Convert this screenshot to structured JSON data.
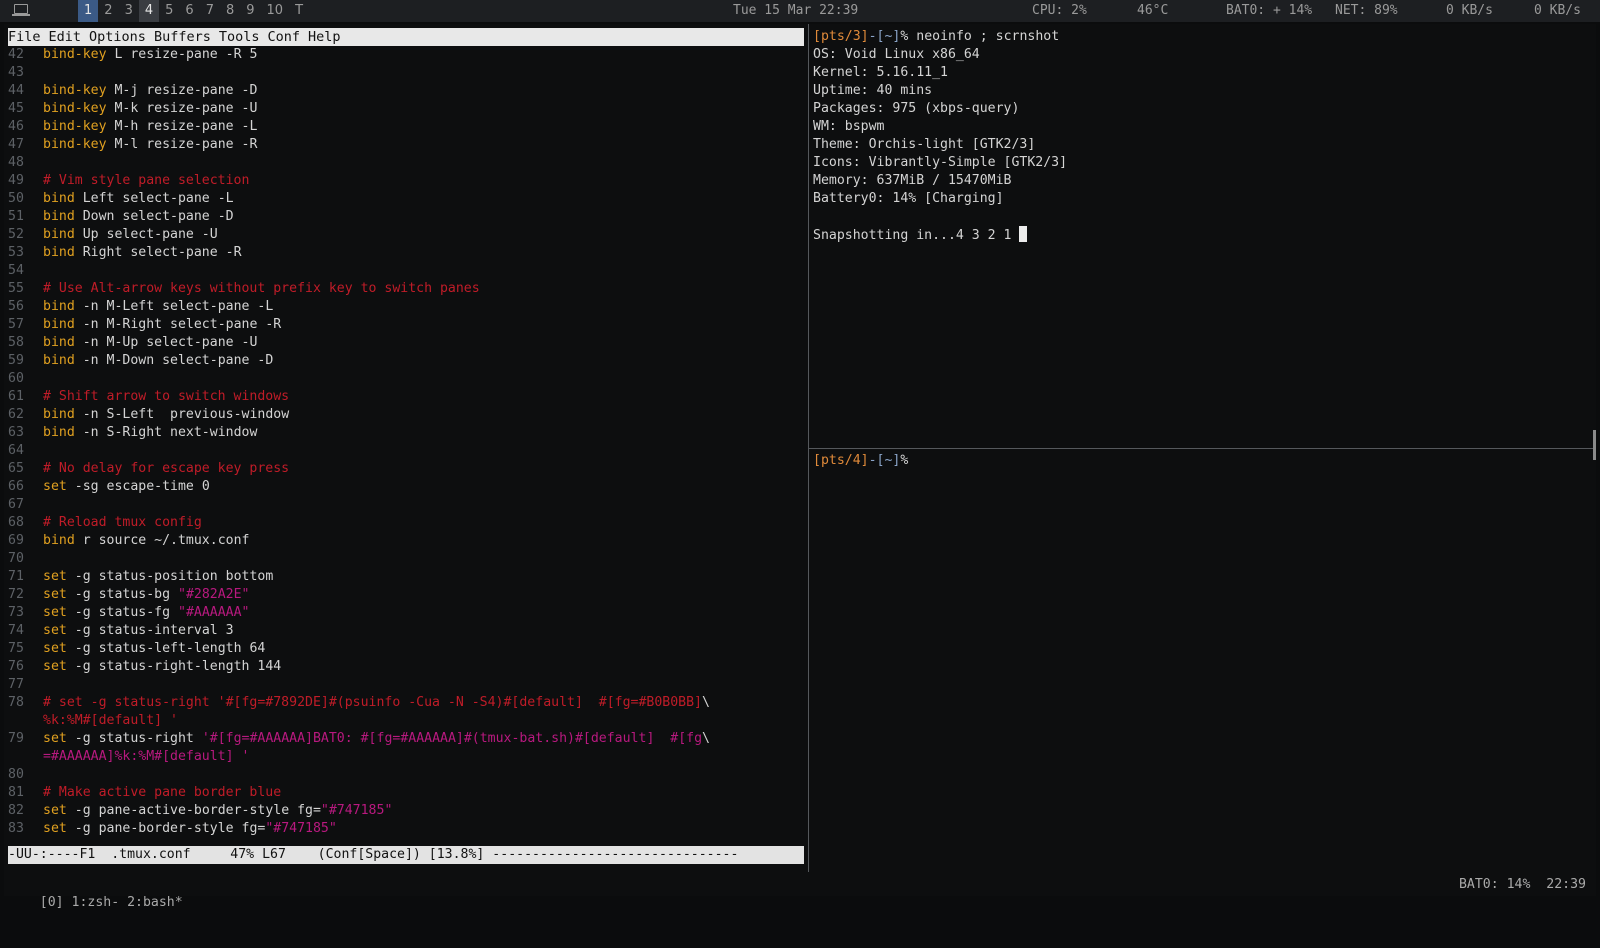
{
  "topbar": {
    "workspaces": [
      {
        "label": "1",
        "state": "focused"
      },
      {
        "label": "2",
        "state": "empty"
      },
      {
        "label": "3",
        "state": "empty"
      },
      {
        "label": "4",
        "state": "occupied"
      },
      {
        "label": "5",
        "state": "empty"
      },
      {
        "label": "6",
        "state": "empty"
      },
      {
        "label": "7",
        "state": "empty"
      },
      {
        "label": "8",
        "state": "empty"
      },
      {
        "label": "9",
        "state": "empty"
      },
      {
        "label": "10",
        "state": "empty"
      },
      {
        "label": "T",
        "state": "empty"
      }
    ],
    "clock": "Tue 15 Mar 22:39",
    "cpu": "CPU:  2%",
    "temp": "46°C",
    "battery": "BAT0: + 14%",
    "net": "NET:  89%",
    "down": "0 KB/s",
    "up": "0 KB/s"
  },
  "emacs": {
    "menu": [
      "File",
      "Edit",
      "Options",
      "Buffers",
      "Tools",
      "Conf",
      "Help"
    ],
    "lines": [
      {
        "n": "42",
        "seg": [
          [
            "kw",
            "bind-key"
          ],
          [
            "",
            "L resize-pane -R 5"
          ]
        ]
      },
      {
        "n": "43",
        "seg": []
      },
      {
        "n": "44",
        "seg": [
          [
            "kw",
            "bind-key"
          ],
          [
            "",
            "M-j resize-pane -D"
          ]
        ]
      },
      {
        "n": "45",
        "seg": [
          [
            "kw",
            "bind-key"
          ],
          [
            "",
            "M-k resize-pane -U"
          ]
        ]
      },
      {
        "n": "46",
        "seg": [
          [
            "kw",
            "bind-key"
          ],
          [
            "",
            "M-h resize-pane -L"
          ]
        ]
      },
      {
        "n": "47",
        "seg": [
          [
            "kw",
            "bind-key"
          ],
          [
            "",
            "M-l resize-pane -R"
          ]
        ]
      },
      {
        "n": "48",
        "seg": []
      },
      {
        "n": "49",
        "seg": [
          [
            "cm",
            "# Vim style pane selection"
          ]
        ]
      },
      {
        "n": "50",
        "seg": [
          [
            "kw",
            "bind"
          ],
          [
            "",
            "Left select-pane -L"
          ]
        ]
      },
      {
        "n": "51",
        "seg": [
          [
            "kw",
            "bind"
          ],
          [
            "",
            "Down select-pane -D"
          ]
        ]
      },
      {
        "n": "52",
        "seg": [
          [
            "kw",
            "bind"
          ],
          [
            "",
            "Up select-pane -U"
          ]
        ]
      },
      {
        "n": "53",
        "seg": [
          [
            "kw",
            "bind"
          ],
          [
            "",
            "Right select-pane -R"
          ]
        ]
      },
      {
        "n": "54",
        "seg": []
      },
      {
        "n": "55",
        "seg": [
          [
            "cm",
            "# Use Alt-arrow keys without prefix key to switch panes"
          ]
        ]
      },
      {
        "n": "56",
        "seg": [
          [
            "kw",
            "bind"
          ],
          [
            "",
            "-n M-Left select-pane -L"
          ]
        ]
      },
      {
        "n": "57",
        "seg": [
          [
            "kw",
            "bind"
          ],
          [
            "",
            "-n M-Right select-pane -R"
          ]
        ]
      },
      {
        "n": "58",
        "seg": [
          [
            "kw",
            "bind"
          ],
          [
            "",
            "-n M-Up select-pane -U"
          ]
        ]
      },
      {
        "n": "59",
        "seg": [
          [
            "kw",
            "bind"
          ],
          [
            "",
            "-n M-Down select-pane -D"
          ]
        ]
      },
      {
        "n": "60",
        "seg": []
      },
      {
        "n": "61",
        "seg": [
          [
            "cm",
            "# Shift arrow to switch windows"
          ]
        ]
      },
      {
        "n": "62",
        "seg": [
          [
            "kw",
            "bind"
          ],
          [
            "",
            "-n S-Left  previous-window"
          ]
        ]
      },
      {
        "n": "63",
        "seg": [
          [
            "kw",
            "bind"
          ],
          [
            "",
            "-n S-Right next-window"
          ]
        ]
      },
      {
        "n": "64",
        "seg": []
      },
      {
        "n": "65",
        "seg": [
          [
            "cm",
            "# No delay for escape key press"
          ]
        ]
      },
      {
        "n": "66",
        "seg": [
          [
            "kw",
            "set"
          ],
          [
            "",
            "-sg escape-time 0"
          ]
        ]
      },
      {
        "n": "67",
        "seg": []
      },
      {
        "n": "68",
        "seg": [
          [
            "cm",
            "# Reload tmux config"
          ]
        ]
      },
      {
        "n": "69",
        "seg": [
          [
            "kw",
            "bind"
          ],
          [
            "",
            "r source ~/.tmux.conf"
          ]
        ]
      },
      {
        "n": "70",
        "seg": []
      },
      {
        "n": "71",
        "seg": [
          [
            "kw",
            "set"
          ],
          [
            "",
            "-g status-position bottom"
          ]
        ]
      },
      {
        "n": "72",
        "seg": [
          [
            "kw",
            "set"
          ],
          [
            "",
            "-g status-bg "
          ],
          [
            "st",
            "\"#282A2E\""
          ]
        ]
      },
      {
        "n": "73",
        "seg": [
          [
            "kw",
            "set"
          ],
          [
            "",
            "-g status-fg "
          ],
          [
            "st",
            "\"#AAAAAA\""
          ]
        ]
      },
      {
        "n": "74",
        "seg": [
          [
            "kw",
            "set"
          ],
          [
            "",
            "-g status-interval 3"
          ]
        ]
      },
      {
        "n": "75",
        "seg": [
          [
            "kw",
            "set"
          ],
          [
            "",
            "-g status-left-length 64"
          ]
        ]
      },
      {
        "n": "76",
        "seg": [
          [
            "kw",
            "set"
          ],
          [
            "",
            "-g status-right-length 144"
          ]
        ]
      },
      {
        "n": "77",
        "seg": []
      },
      {
        "n": "78",
        "seg": [
          [
            "cm",
            "# set -g status-right '#[fg=#7892DE]#(psuinfo -Cua -N -S4)#[default]  #[fg=#B0B0BB]"
          ],
          [
            "",
            "\\"
          ]
        ]
      },
      {
        "n": "",
        "seg": [
          [
            "cm",
            "%k:%M#[default] '"
          ]
        ]
      },
      {
        "n": "79",
        "seg": [
          [
            "kw",
            "set"
          ],
          [
            "",
            "-g status-right "
          ],
          [
            "st",
            "'#[fg=#AAAAAA]BAT0: #[fg=#AAAAAA]#(tmux-bat.sh)#[default]  #[fg"
          ],
          [
            "",
            "\\"
          ]
        ]
      },
      {
        "n": "",
        "seg": [
          [
            "st",
            "=#AAAAAA]%k:%M#[default] '"
          ]
        ]
      },
      {
        "n": "80",
        "seg": []
      },
      {
        "n": "81",
        "seg": [
          [
            "cm",
            "# Make active pane border blue"
          ]
        ]
      },
      {
        "n": "82",
        "seg": [
          [
            "kw",
            "set"
          ],
          [
            "",
            "-g pane-active-border-style fg="
          ],
          [
            "st",
            "\"#747185\""
          ]
        ]
      },
      {
        "n": "83",
        "seg": [
          [
            "kw",
            "set"
          ],
          [
            "",
            "-g pane-border-style fg="
          ],
          [
            "st",
            "\"#747185\""
          ]
        ]
      }
    ],
    "modeline": "-UU-:----F1  .tmux.conf     47% L67    (Conf[Space]) [13.8%] -------------------------------"
  },
  "shell1": {
    "prompt_tty": "[pts/3]",
    "prompt_dir": "[~]",
    "command": "neoinfo ; scrnshot",
    "output": [
      "OS: Void Linux x86_64",
      "Kernel: 5.16.11_1",
      "Uptime: 40 mins",
      "Packages: 975 (xbps-query)",
      "WM: bspwm",
      "Theme: Orchis-light [GTK2/3]",
      "Icons: Vibrantly-Simple [GTK2/3]",
      "Memory: 637MiB / 15470MiB",
      "Battery0: 14% [Charging]",
      ""
    ],
    "snapshot": "Snapshotting in...4 3 2 1 "
  },
  "shell2": {
    "prompt_tty": "[pts/4]",
    "prompt_dir": "[~]"
  },
  "tmux": {
    "left": "[0] 1:zsh- 2:bash*",
    "right": "BAT0: 14%  22:39"
  }
}
